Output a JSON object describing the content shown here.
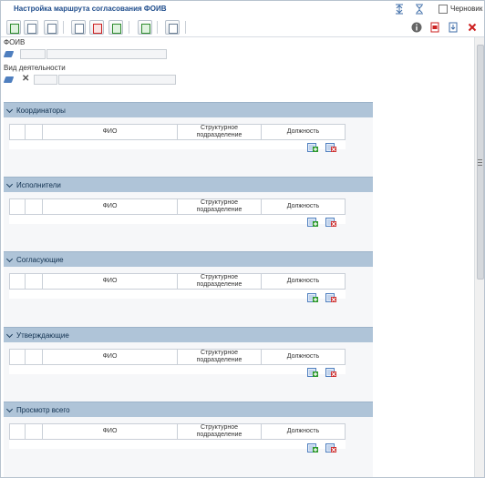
{
  "window": {
    "title": "Настройка маршрута согласования ФОИВ",
    "draft_label": "Черновик"
  },
  "toolbar": {
    "left_icons": [
      "add-icon",
      "copy-icon",
      "move-icon",
      "import-icon",
      "export-icon",
      "approve-icon",
      "route-icon",
      "print-icon"
    ],
    "right_icons": [
      "info-icon",
      "pdf-icon",
      "download-icon",
      "close-icon"
    ]
  },
  "fields": {
    "foiv_label": "ФОИВ",
    "activity_label": "Вид деятельности"
  },
  "table_headers": {
    "fio": "ФИО",
    "department_line1": "Структурное",
    "department_line2": "подразделение",
    "position": "Должность"
  },
  "sections": [
    {
      "title": "Координаторы"
    },
    {
      "title": "Исполнители"
    },
    {
      "title": "Согласующие"
    },
    {
      "title": "Утверждающие"
    },
    {
      "title": "Просмотр всего"
    }
  ],
  "colors": {
    "section_header": "#afc4d8",
    "title_text": "#1f4d8c"
  }
}
